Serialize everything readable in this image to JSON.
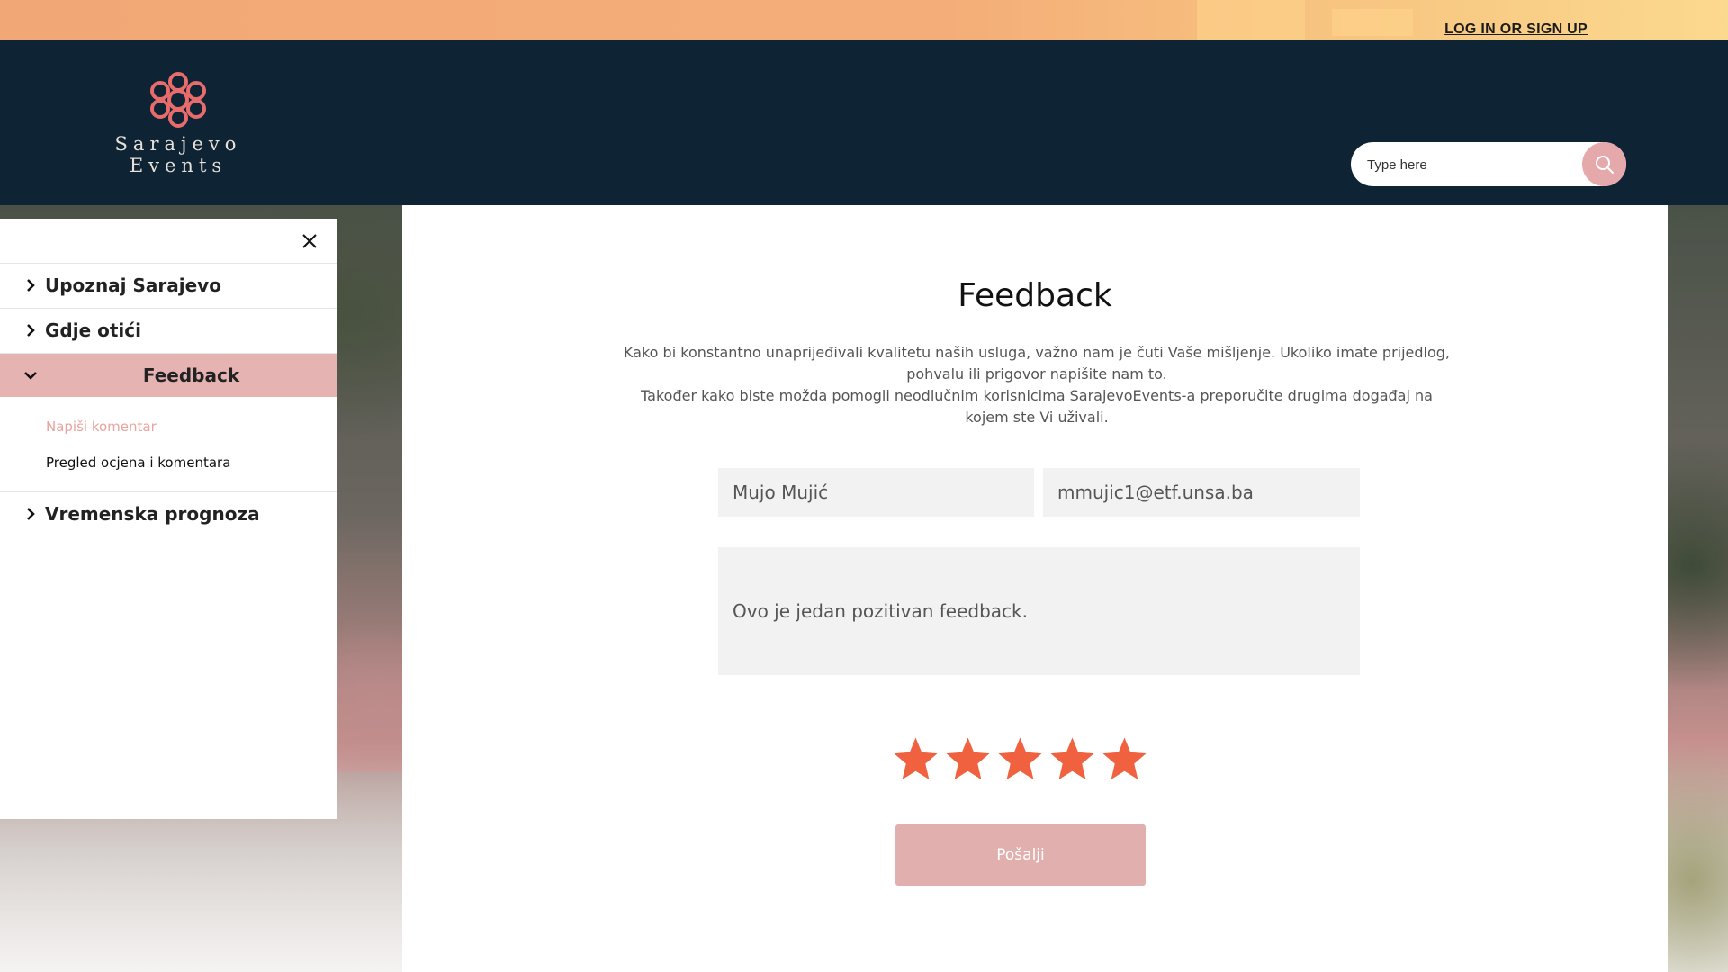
{
  "topbar": {
    "login_label": "LOG IN OR SIGN UP"
  },
  "header": {
    "logo_line1": "Sarajevo",
    "logo_line2": "Events",
    "search_placeholder": "Type here",
    "search_icon": "search-icon"
  },
  "sidebar": {
    "close_icon": "close-icon",
    "items": [
      {
        "label": "Upoznaj Sarajevo",
        "icon": "chevron-right-icon",
        "expanded": false
      },
      {
        "label": "Gdje otići",
        "icon": "chevron-right-icon",
        "expanded": false
      },
      {
        "label": "Feedback",
        "icon": "chevron-down-icon",
        "expanded": true
      },
      {
        "label": "Vremenska prognoza",
        "icon": "chevron-right-icon",
        "expanded": false
      }
    ],
    "subitems": [
      {
        "label": "Napiši komentar",
        "active": true
      },
      {
        "label": "Pregled ocjena i komentara",
        "active": false
      }
    ]
  },
  "main": {
    "title": "Feedback",
    "intro_line1": "Kako bi konstantno unaprijeđivali kvalitetu naših usluga, važno nam je čuti Vaše mišljenje. Ukoliko imate prijedlog, pohvalu ili prigovor napišite nam to.",
    "intro_line2": "Također kako biste možda pomogli neodlučnim korisnicima SarajevoEvents-a preporučite drugima događaj na kojem ste Vi uživali.",
    "name_value": "Mujo Mujić",
    "email_value": "mmujic1@etf.unsa.ba",
    "comment_value": "Ovo je jedan pozitivan feedback.",
    "rating": 5,
    "rating_max": 5,
    "send_label": "Pošalji"
  },
  "colors": {
    "header_bg": "#0e2333",
    "accent_pink": "#e5b3b2",
    "star": "#f0623f",
    "active_sublink": "#e9a3a0"
  }
}
